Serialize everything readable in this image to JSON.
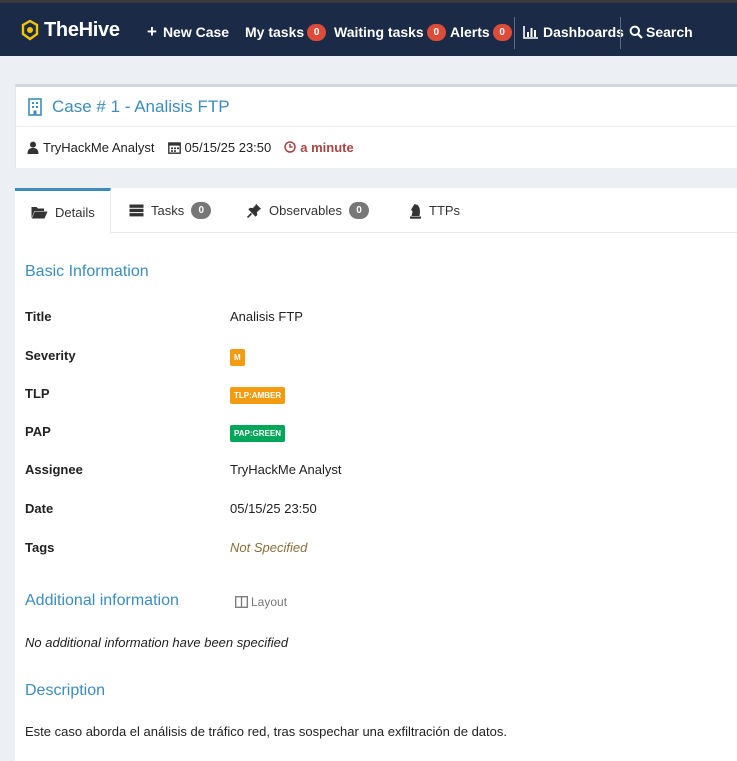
{
  "nav": {
    "brand": "TheHive",
    "new_case": "New Case",
    "my_tasks": "My tasks",
    "my_tasks_count": "0",
    "waiting_tasks": "Waiting tasks",
    "waiting_tasks_count": "0",
    "alerts": "Alerts",
    "alerts_count": "0",
    "dashboards": "Dashboards",
    "search": "Search"
  },
  "case": {
    "title": "Case # 1 - Analisis FTP",
    "assignee": "TryHackMe Analyst",
    "date": "05/15/25 23:50",
    "duration": "a minute"
  },
  "tabs": {
    "details": "Details",
    "tasks": "Tasks",
    "tasks_count": "0",
    "observables": "Observables",
    "observables_count": "0",
    "ttps": "TTPs"
  },
  "basic": {
    "heading": "Basic Information",
    "title_label": "Title",
    "title_value": "Analisis FTP",
    "severity_label": "Severity",
    "severity_value": "M",
    "tlp_label": "TLP",
    "tlp_value": "TLP:AMBER",
    "pap_label": "PAP",
    "pap_value": "PAP:GREEN",
    "assignee_label": "Assignee",
    "assignee_value": "TryHackMe Analyst",
    "date_label": "Date",
    "date_value": "05/15/25 23:50",
    "tags_label": "Tags",
    "tags_value": "Not Specified"
  },
  "additional": {
    "heading": "Additional information",
    "layout_label": "Layout",
    "empty_text": "No additional information have been specified"
  },
  "description": {
    "heading": "Description",
    "text": "Este caso aborda el análisis de tráfico red, tras sospechar una exfiltración de datos."
  },
  "colors": {
    "nav_bg": "#1b2a47",
    "accent": "#3c8dbc",
    "badge_red": "#dd4b39",
    "amber": "#f39c12",
    "green": "#00a65a",
    "duration_red": "#a94442"
  }
}
